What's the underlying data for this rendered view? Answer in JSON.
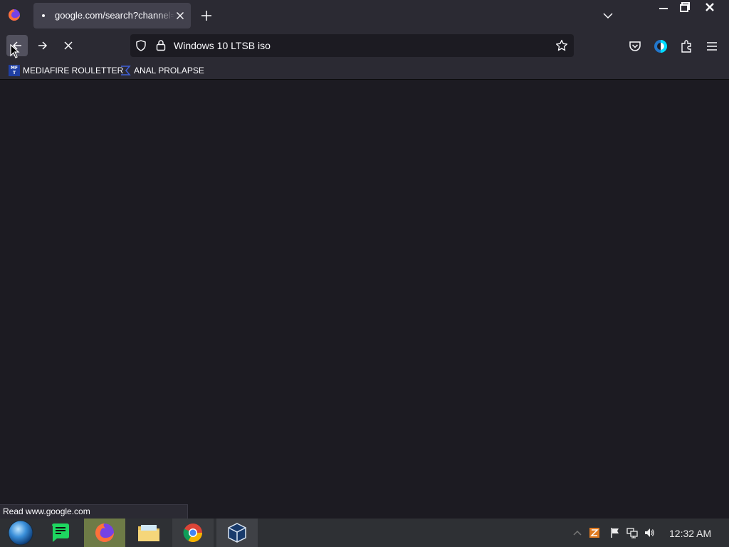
{
  "browser": {
    "tab": {
      "title": "google.com/search?channel=fs"
    },
    "url_bar": {
      "value": "Windows 10 LTSB iso"
    },
    "bookmarks": [
      {
        "label": "MEDIAFIRE ROULETTER",
        "icon_text": "MF T"
      },
      {
        "label": "ANAL PROLAPSE"
      }
    ],
    "status_text": "Read www.google.com",
    "colors": {
      "chrome": "#2b2a33",
      "content": "#1c1b22",
      "accent": "#00ddff"
    }
  },
  "taskbar": {
    "apps": [
      "start-orb",
      "green-app",
      "firefox",
      "file-explorer",
      "chrome",
      "virtualbox"
    ],
    "active_app": "firefox",
    "clock": "12:32 AM"
  }
}
